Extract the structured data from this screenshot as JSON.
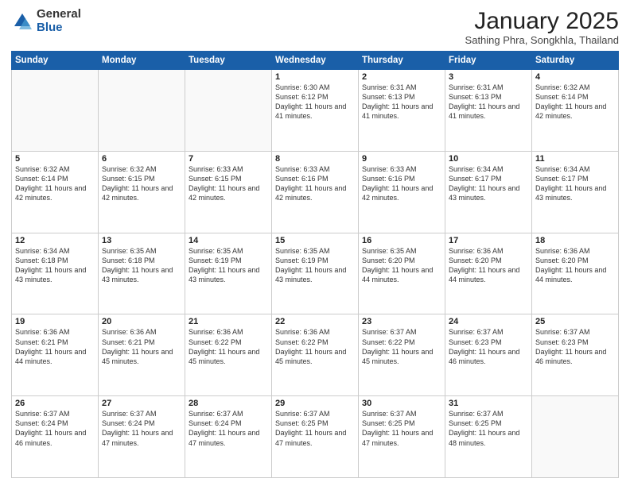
{
  "logo": {
    "general": "General",
    "blue": "Blue"
  },
  "header": {
    "month": "January 2025",
    "location": "Sathing Phra, Songkhla, Thailand"
  },
  "weekdays": [
    "Sunday",
    "Monday",
    "Tuesday",
    "Wednesday",
    "Thursday",
    "Friday",
    "Saturday"
  ],
  "weeks": [
    [
      {
        "day": "",
        "info": ""
      },
      {
        "day": "",
        "info": ""
      },
      {
        "day": "",
        "info": ""
      },
      {
        "day": "1",
        "info": "Sunrise: 6:30 AM\nSunset: 6:12 PM\nDaylight: 11 hours and 41 minutes."
      },
      {
        "day": "2",
        "info": "Sunrise: 6:31 AM\nSunset: 6:13 PM\nDaylight: 11 hours and 41 minutes."
      },
      {
        "day": "3",
        "info": "Sunrise: 6:31 AM\nSunset: 6:13 PM\nDaylight: 11 hours and 41 minutes."
      },
      {
        "day": "4",
        "info": "Sunrise: 6:32 AM\nSunset: 6:14 PM\nDaylight: 11 hours and 42 minutes."
      }
    ],
    [
      {
        "day": "5",
        "info": "Sunrise: 6:32 AM\nSunset: 6:14 PM\nDaylight: 11 hours and 42 minutes."
      },
      {
        "day": "6",
        "info": "Sunrise: 6:32 AM\nSunset: 6:15 PM\nDaylight: 11 hours and 42 minutes."
      },
      {
        "day": "7",
        "info": "Sunrise: 6:33 AM\nSunset: 6:15 PM\nDaylight: 11 hours and 42 minutes."
      },
      {
        "day": "8",
        "info": "Sunrise: 6:33 AM\nSunset: 6:16 PM\nDaylight: 11 hours and 42 minutes."
      },
      {
        "day": "9",
        "info": "Sunrise: 6:33 AM\nSunset: 6:16 PM\nDaylight: 11 hours and 42 minutes."
      },
      {
        "day": "10",
        "info": "Sunrise: 6:34 AM\nSunset: 6:17 PM\nDaylight: 11 hours and 43 minutes."
      },
      {
        "day": "11",
        "info": "Sunrise: 6:34 AM\nSunset: 6:17 PM\nDaylight: 11 hours and 43 minutes."
      }
    ],
    [
      {
        "day": "12",
        "info": "Sunrise: 6:34 AM\nSunset: 6:18 PM\nDaylight: 11 hours and 43 minutes."
      },
      {
        "day": "13",
        "info": "Sunrise: 6:35 AM\nSunset: 6:18 PM\nDaylight: 11 hours and 43 minutes."
      },
      {
        "day": "14",
        "info": "Sunrise: 6:35 AM\nSunset: 6:19 PM\nDaylight: 11 hours and 43 minutes."
      },
      {
        "day": "15",
        "info": "Sunrise: 6:35 AM\nSunset: 6:19 PM\nDaylight: 11 hours and 43 minutes."
      },
      {
        "day": "16",
        "info": "Sunrise: 6:35 AM\nSunset: 6:20 PM\nDaylight: 11 hours and 44 minutes."
      },
      {
        "day": "17",
        "info": "Sunrise: 6:36 AM\nSunset: 6:20 PM\nDaylight: 11 hours and 44 minutes."
      },
      {
        "day": "18",
        "info": "Sunrise: 6:36 AM\nSunset: 6:20 PM\nDaylight: 11 hours and 44 minutes."
      }
    ],
    [
      {
        "day": "19",
        "info": "Sunrise: 6:36 AM\nSunset: 6:21 PM\nDaylight: 11 hours and 44 minutes."
      },
      {
        "day": "20",
        "info": "Sunrise: 6:36 AM\nSunset: 6:21 PM\nDaylight: 11 hours and 45 minutes."
      },
      {
        "day": "21",
        "info": "Sunrise: 6:36 AM\nSunset: 6:22 PM\nDaylight: 11 hours and 45 minutes."
      },
      {
        "day": "22",
        "info": "Sunrise: 6:36 AM\nSunset: 6:22 PM\nDaylight: 11 hours and 45 minutes."
      },
      {
        "day": "23",
        "info": "Sunrise: 6:37 AM\nSunset: 6:22 PM\nDaylight: 11 hours and 45 minutes."
      },
      {
        "day": "24",
        "info": "Sunrise: 6:37 AM\nSunset: 6:23 PM\nDaylight: 11 hours and 46 minutes."
      },
      {
        "day": "25",
        "info": "Sunrise: 6:37 AM\nSunset: 6:23 PM\nDaylight: 11 hours and 46 minutes."
      }
    ],
    [
      {
        "day": "26",
        "info": "Sunrise: 6:37 AM\nSunset: 6:24 PM\nDaylight: 11 hours and 46 minutes."
      },
      {
        "day": "27",
        "info": "Sunrise: 6:37 AM\nSunset: 6:24 PM\nDaylight: 11 hours and 47 minutes."
      },
      {
        "day": "28",
        "info": "Sunrise: 6:37 AM\nSunset: 6:24 PM\nDaylight: 11 hours and 47 minutes."
      },
      {
        "day": "29",
        "info": "Sunrise: 6:37 AM\nSunset: 6:25 PM\nDaylight: 11 hours and 47 minutes."
      },
      {
        "day": "30",
        "info": "Sunrise: 6:37 AM\nSunset: 6:25 PM\nDaylight: 11 hours and 47 minutes."
      },
      {
        "day": "31",
        "info": "Sunrise: 6:37 AM\nSunset: 6:25 PM\nDaylight: 11 hours and 48 minutes."
      },
      {
        "day": "",
        "info": ""
      }
    ]
  ]
}
